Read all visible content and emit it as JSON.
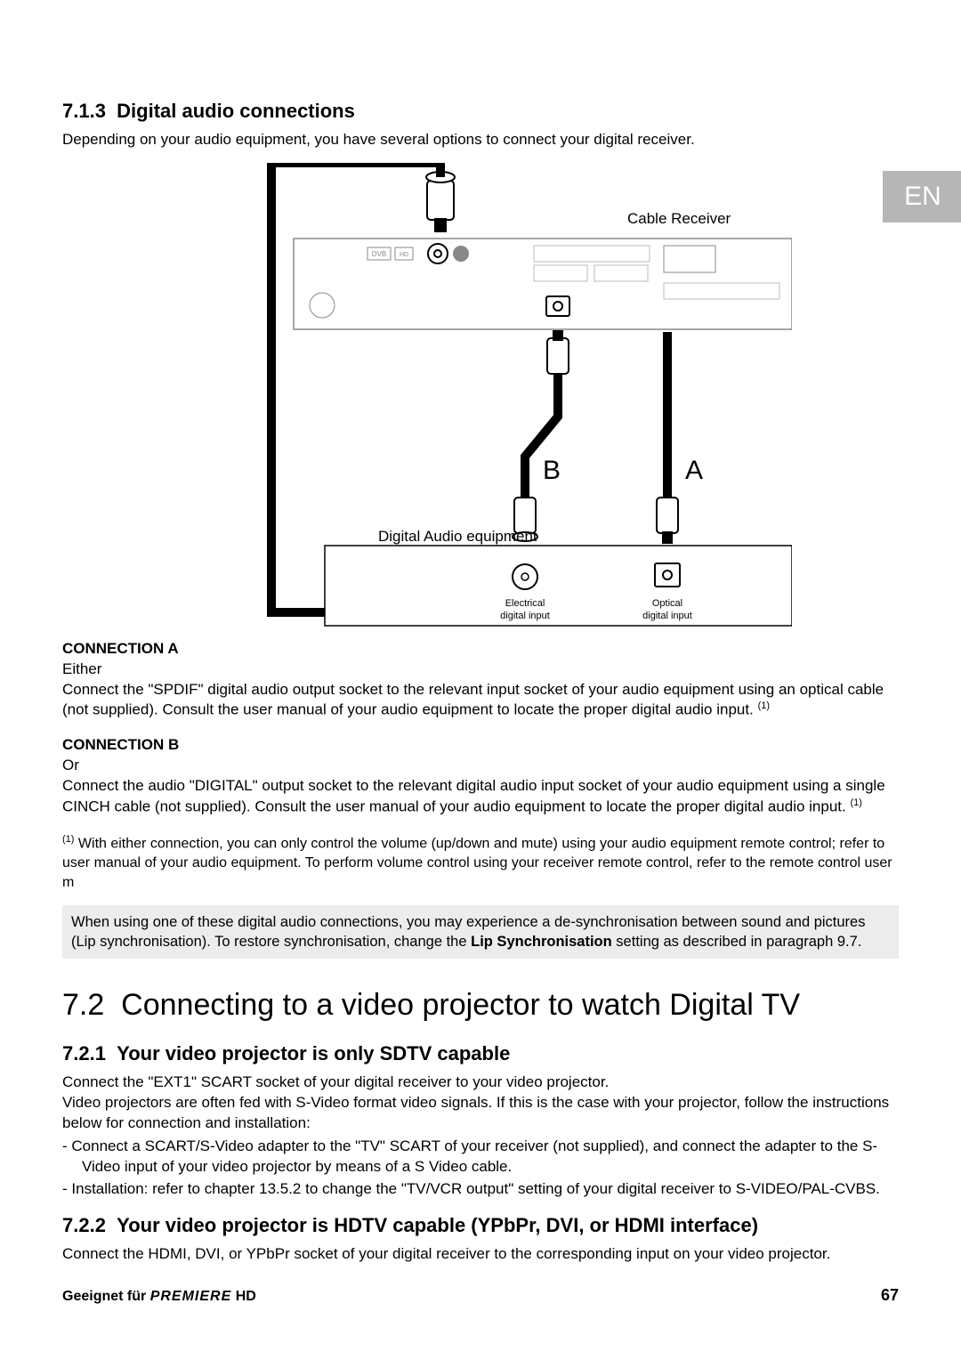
{
  "lang_tab": "EN",
  "sec713": {
    "num": "7.1.3",
    "title": "Digital audio connections",
    "intro": "Depending on your audio equipment, you have several options to connect your digital receiver."
  },
  "diagram": {
    "cable_receiver": "Cable Receiver",
    "a": "A",
    "b": "B",
    "dae": "Digital Audio equipment",
    "elec1": "Electrical",
    "elec2": "digital input",
    "opt1": "Optical",
    "opt2": "digital input",
    "dvb": "DVB",
    "hd": "HD"
  },
  "connA": {
    "head": "CONNECTION A",
    "either": "Either",
    "text1": "Connect the \"SPDIF\" digital audio output socket to the relevant input socket of your audio equipment using an optical cable (not supplied). Consult the user manual of your audio equipment to locate the proper digital audio input.",
    "sup": "(1)"
  },
  "connB": {
    "head": "CONNECTION B",
    "or": "Or",
    "text1": "Connect the audio \"DIGITAL\" output socket to the relevant digital audio input socket of your audio equipment using a single CINCH cable (not supplied). Consult the user manual of your audio equipment to locate the proper digital audio input.",
    "sup": "(1)"
  },
  "footnote": {
    "sup": "(1)",
    "text": "With either connection, you can only control the volume (up/down and mute) using your audio equipment remote control; refer to user manual of your audio equipment. To perform volume control using your receiver remote control, refer to the remote control user m"
  },
  "notebox": {
    "line1": "When using one of these digital audio connections, you may experience a de-synchronisation between sound and pictures",
    "line2a": "(Lip synchronisation). To restore synchronisation, change the ",
    "bold": "Lip Synchronisation",
    "line2b": " setting as described in paragraph 9.7."
  },
  "sec72": {
    "num": "7.2",
    "title": "Connecting to a video projector to watch Digital TV"
  },
  "sec721": {
    "num": "7.2.1",
    "title": "Your video projector is only SDTV capable",
    "p1": "Connect the \"EXT1\" SCART socket of your digital receiver to your video projector.",
    "p2": "Video projectors are often fed with S-Video format video signals. If this is the case with your projector, follow the instructions below for connection and installation:",
    "li1": "Connect a SCART/S-Video adapter to the \"TV\" SCART of your receiver (not supplied), and connect the adapter to the S-Video input of your video projector by means of a S Video cable.",
    "li2": "Installation: refer to chapter 13.5.2 to change the \"TV/VCR output\" setting of your digital receiver to S-VIDEO/PAL-CVBS."
  },
  "sec722": {
    "num": "7.2.2",
    "title": "Your video projector is HDTV capable (YPbPr, DVI, or HDMI interface)",
    "p1": "Connect the HDMI, DVI, or YPbPr socket of your digital receiver to the corresponding input on your video projector."
  },
  "footer": {
    "left1": "Geeignet für ",
    "brand": "PREMIERE",
    "hd": " HD",
    "page": "67"
  }
}
